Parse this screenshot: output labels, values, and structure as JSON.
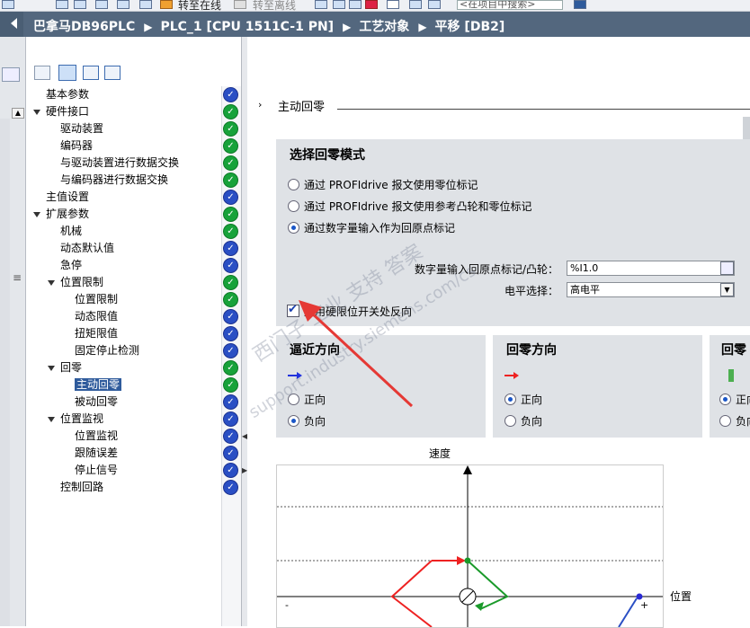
{
  "toolbar": {
    "go_online": "转至在线",
    "go_offline": "转至离线",
    "search_placeholder": "<在项目中搜索>"
  },
  "breadcrumb": [
    "巴拿马DB96PLC",
    "PLC_1 [CPU 1511C-1 PN]",
    "工艺对象",
    "平移 [DB2]"
  ],
  "tree": [
    {
      "label": "基本参数",
      "level": 0,
      "expand": false,
      "status": "blue"
    },
    {
      "label": "硬件接口",
      "level": 0,
      "expand": true,
      "status": "green"
    },
    {
      "label": "驱动装置",
      "level": 1,
      "expand": false,
      "status": "green"
    },
    {
      "label": "编码器",
      "level": 1,
      "expand": false,
      "status": "green"
    },
    {
      "label": "与驱动装置进行数据交换",
      "level": 1,
      "expand": false,
      "status": "green"
    },
    {
      "label": "与编码器进行数据交换",
      "level": 1,
      "expand": false,
      "status": "green"
    },
    {
      "label": "主值设置",
      "level": 0,
      "expand": false,
      "status": "blue"
    },
    {
      "label": "扩展参数",
      "level": 0,
      "expand": true,
      "status": "green"
    },
    {
      "label": "机械",
      "level": 1,
      "expand": false,
      "status": "green"
    },
    {
      "label": "动态默认值",
      "level": 1,
      "expand": false,
      "status": "blue"
    },
    {
      "label": "急停",
      "level": 1,
      "expand": false,
      "status": "blue"
    },
    {
      "label": "位置限制",
      "level": 1,
      "expand": true,
      "status": "green"
    },
    {
      "label": "位置限制",
      "level": 2,
      "expand": false,
      "status": "green"
    },
    {
      "label": "动态限值",
      "level": 2,
      "expand": false,
      "status": "blue"
    },
    {
      "label": "扭矩限值",
      "level": 2,
      "expand": false,
      "status": "blue"
    },
    {
      "label": "固定停止检测",
      "level": 2,
      "expand": false,
      "status": "blue"
    },
    {
      "label": "回零",
      "level": 1,
      "expand": true,
      "status": "green"
    },
    {
      "label": "主动回零",
      "level": 2,
      "expand": false,
      "status": "green",
      "selected": true
    },
    {
      "label": "被动回零",
      "level": 2,
      "expand": false,
      "status": "blue"
    },
    {
      "label": "位置监视",
      "level": 1,
      "expand": true,
      "status": "blue"
    },
    {
      "label": "位置监视",
      "level": 2,
      "expand": false,
      "status": "blue"
    },
    {
      "label": "跟随误差",
      "level": 2,
      "expand": false,
      "status": "blue"
    },
    {
      "label": "停止信号",
      "level": 2,
      "expand": false,
      "status": "blue"
    },
    {
      "label": "控制回路",
      "level": 1,
      "expand": false,
      "status": "blue"
    }
  ],
  "section_title": "主动回零",
  "mode": {
    "title": "选择回零模式",
    "options": [
      {
        "label": "通过 PROFIdrive 报文使用零位标记",
        "selected": false
      },
      {
        "label": "通过 PROFIdrive 报文使用参考凸轮和零位标记",
        "selected": false
      },
      {
        "label": "通过数字量输入作为回原点标记",
        "selected": true
      }
    ],
    "input_label": "数字量输入回原点标记/凸轮：",
    "input_value": "%I1.0",
    "level_label": "电平选择：",
    "level_value": "高电平",
    "reverse_label": "启用硬限位开关处反向",
    "reverse_checked": true
  },
  "approach": {
    "title": "逼近方向",
    "pos": "正向",
    "neg": "负向",
    "selected": "neg"
  },
  "homing_dir": {
    "title": "回零方向",
    "pos": "正向",
    "neg": "负向",
    "selected": "pos"
  },
  "third": {
    "title": "回零",
    "pos": "正向",
    "neg": "负向",
    "selected": "pos"
  },
  "chart": {
    "y_label": "速度",
    "x_label": "位置",
    "minus": "-",
    "plus": "+"
  },
  "watermark": {
    "line1": "西门子 工业 支持 答案",
    "line2": "support.industry.siemens.com/cs"
  },
  "colors": {
    "breadcrumb_bg": "#53677e",
    "selected": "#2f5b9c",
    "ok_green": "#17a23a",
    "ok_blue": "#2a4fc4",
    "panel": "#dfe2e6"
  }
}
